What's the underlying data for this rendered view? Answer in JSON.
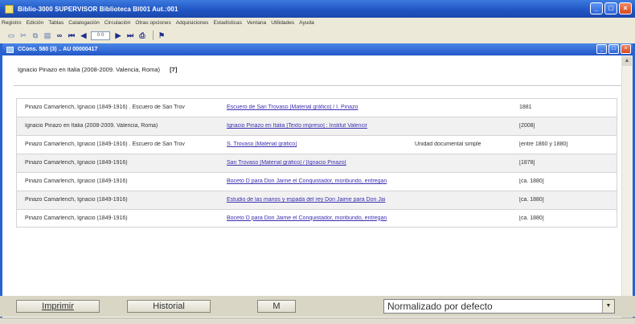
{
  "window": {
    "title": "Biblio-3000 SUPERVISOR  Biblioteca BI001 Aut.:001",
    "controls": [
      "_",
      "□",
      "×"
    ]
  },
  "menu": [
    "Registro",
    "Edición",
    "Tablas",
    "Catalogación",
    "Circulación",
    "Otras opciones",
    "Adquisiciones",
    "Estadísticas",
    "Ventana",
    "Utilidades",
    "Ayuda"
  ],
  "toolbar": {
    "record_field": "0 0"
  },
  "inner_window": {
    "title": "CCons. 580 (3) .. AU 00000417",
    "controls": [
      "_",
      "□",
      "×"
    ]
  },
  "header": {
    "query": "Ignacio Pinazo en Italia (2008-2009. Valencia, Roma)",
    "count": "[7]"
  },
  "rows": [
    {
      "author": "Pinazo Camarlench, Ignacio (1849-1916) . Escuero de San Trov",
      "title": "Escuero de San Trovaso [Material gráfico] / I. Pinazo",
      "type": "",
      "date": "1881"
    },
    {
      "author": "Ignacio Pinazo en Italia (2008-2009. Valencia, Roma)",
      "title": "Ignacio Pinazo en Italia [Texto impreso] : Institut Valencir",
      "type": "",
      "date": "[2008]"
    },
    {
      "author": "Pinazo Camarlench, Ignacio (1849-1916) . Escuero de San Trov",
      "title": "S. Trovaso [Material gráfico]",
      "type": "Unidad documental simple",
      "date": "[entre 1860 y 1880]"
    },
    {
      "author": "Pinazo Camarlench, Ignacio (1849-1916)",
      "title": "San Trovaso [Material gráfico] / [Ignacio Pinazo]",
      "type": "",
      "date": "[1878]"
    },
    {
      "author": "Pinazo Camarlench, Ignacio (1849-1916)",
      "title": "Boceto D para Don Jaime el Conquistador, moribundo, entregan",
      "type": "",
      "date": "[ca. 1880]"
    },
    {
      "author": "Pinazo Camarlench, Ignacio (1849-1916)",
      "title": "Estudio de las manos y espada del rey Don Jaime para Don Jai",
      "type": "",
      "date": "[ca. 1880]"
    },
    {
      "author": "Pinazo Camarlench, Ignacio (1849-1916)",
      "title": "Boceto D para Don Jaime el Conquistador, moribundo, entregan",
      "type": "",
      "date": "[ca. 1880]"
    }
  ],
  "bottom": {
    "print_label": "Imprimir",
    "history_label": "Historial",
    "m_label": "M",
    "format_selected": "Normalizado por defecto"
  }
}
